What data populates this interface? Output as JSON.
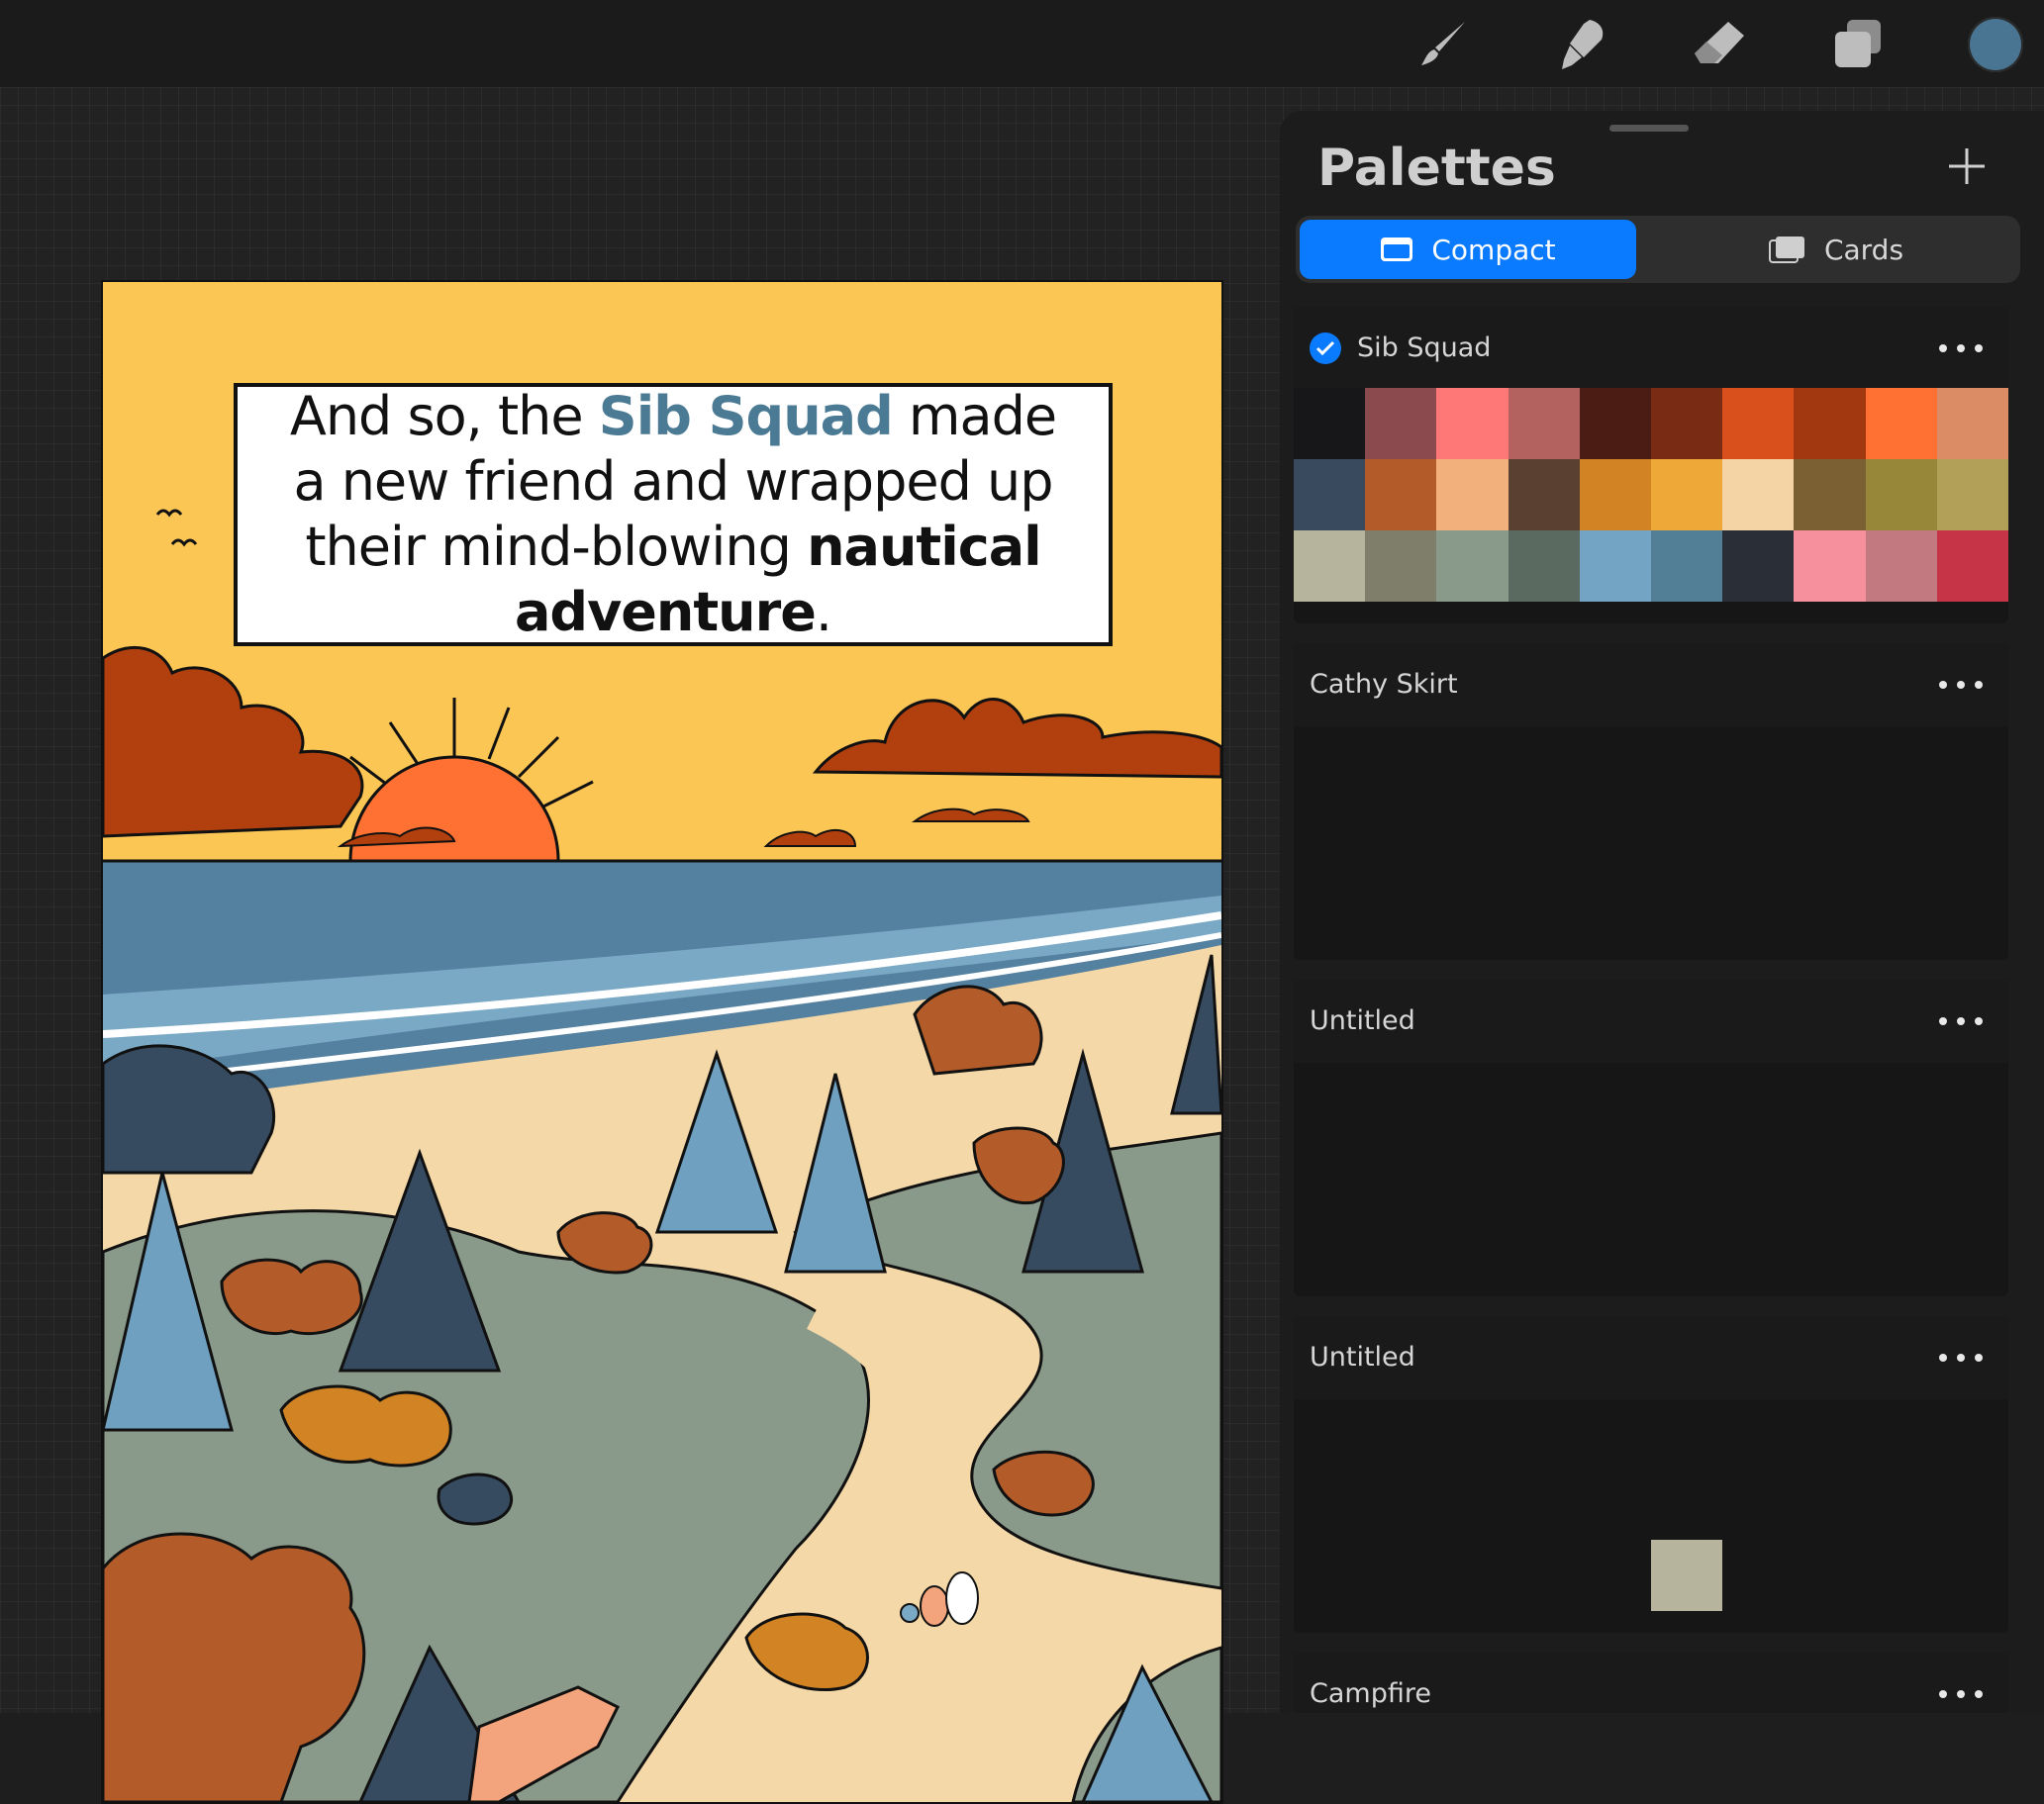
{
  "toolbar": {
    "tools": [
      "paintbrush-icon",
      "smudge-icon",
      "eraser-icon",
      "layers-icon"
    ],
    "current_color": "#4a7592"
  },
  "artwork": {
    "caption": {
      "part1": "And so, the ",
      "highlight": "Sib Squad",
      "part2": " made a new friend and wrapped up their mind-blowing ",
      "bold": "nautical adventure",
      "end": "."
    }
  },
  "panel": {
    "title": "Palettes",
    "add_icon": "plus-icon",
    "tabs": [
      {
        "label": "Compact",
        "icon": "compact-icon",
        "active": true
      },
      {
        "label": "Cards",
        "icon": "cards-icon",
        "active": false
      }
    ],
    "palettes": [
      {
        "name": "Sib Squad",
        "default": true,
        "colors": [
          "#17171a",
          "#8a4a4e",
          "#fe7878",
          "#b3625f",
          "#4a1c14",
          "#7a2b14",
          "#d9501c",
          "#a2380f",
          "#fe7133",
          "#dc8c64",
          "#3a4a5e",
          "#b35c2a",
          "#f2b07c",
          "#5a4030",
          "#d28424",
          "#eea838",
          "#f4d4a4",
          "#7a6032",
          "#968838",
          "#b2a058",
          "#b6b49c",
          "#7e7e6a",
          "#8a9a8a",
          "#5a6a60",
          "#74a4c4",
          "#527e96",
          "#2a2e36",
          "#f6909c",
          "#c27a80",
          "#c63448"
        ]
      },
      {
        "name": "Cathy Skirt",
        "default": false,
        "colors": []
      },
      {
        "name": "Untitled",
        "default": false,
        "colors": []
      },
      {
        "name": "Untitled",
        "default": false,
        "colors": [
          "",
          "",
          "",
          "",
          "",
          "",
          "",
          "",
          "",
          "",
          "",
          "",
          "",
          "",
          "",
          "",
          "",
          "",
          "",
          "",
          "",
          "",
          "",
          "",
          "",
          "#b6b49c"
        ]
      },
      {
        "name": "Campfire",
        "default": false,
        "colors": []
      }
    ]
  }
}
